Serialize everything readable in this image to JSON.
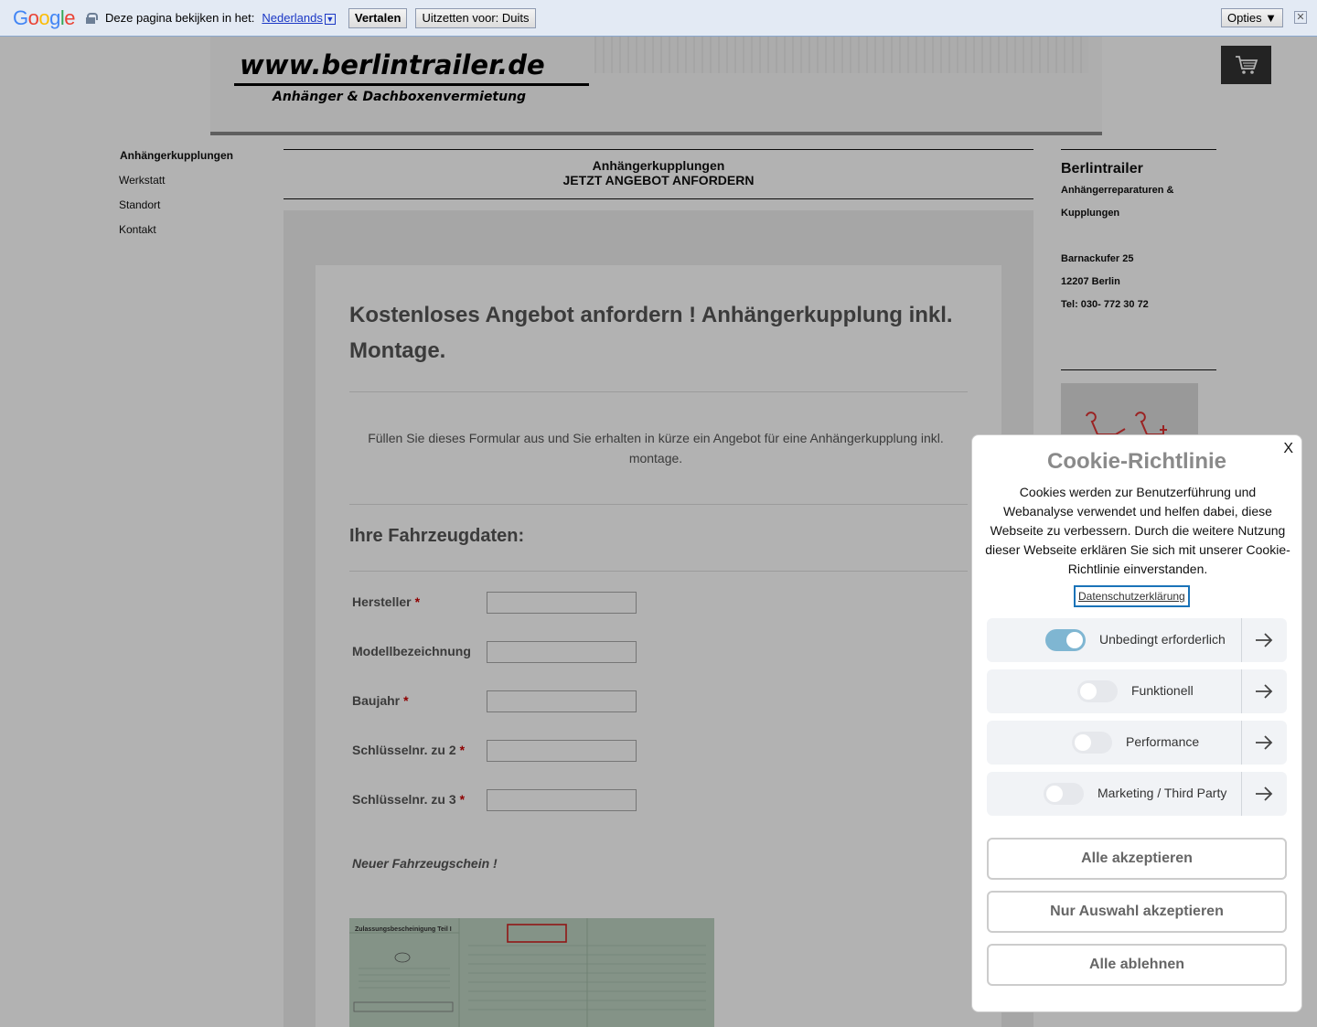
{
  "translate_bar": {
    "logo": "Google",
    "prompt": "Deze pagina bekijken in het:",
    "language": "Nederlands",
    "translate_label": "Vertalen",
    "turn_off_label": "Uitzetten voor: Duits",
    "options_label": "Opties ▼",
    "close_label": "✕"
  },
  "header": {
    "site_title": "www.berlintrailer.de",
    "site_subtitle": "Anhänger & Dachboxenvermietung"
  },
  "nav": {
    "items": [
      {
        "label": "Anhängerkupplungen"
      },
      {
        "label": "Werkstatt"
      },
      {
        "label": "Standort"
      },
      {
        "label": "Kontakt"
      }
    ]
  },
  "main": {
    "heading_line1": "Anhängerkupplungen",
    "heading_line2": "JETZT ANGEBOT ANFORDERN",
    "form_title": "Kostenloses Angebot anfordern ! Anhängerkupplung inkl. Montage.",
    "form_intro": "Füllen Sie dieses Formular aus und Sie erhalten in kürze ein Angebot für eine Anhängerkupplung inkl. montage.",
    "section_title": "Ihre Fahrzeugdaten:",
    "required_mark": "*",
    "fields": [
      {
        "label": "Hersteller",
        "required": true,
        "value": ""
      },
      {
        "label": "Modellbezeichnung",
        "required": false,
        "value": ""
      },
      {
        "label": "Baujahr",
        "required": true,
        "value": ""
      },
      {
        "label": "Schlüsselnr. zu 2",
        "required": true,
        "value": ""
      },
      {
        "label": "Schlüsselnr. zu 3",
        "required": true,
        "value": ""
      }
    ],
    "note": "Neuer Fahrzeugschein !",
    "doc_caption": "Zulassungsbescheinigung Teil I"
  },
  "sidebar": {
    "title": "Berlintrailer",
    "line1": "Anhängerreparaturen &",
    "line2": "Kupplungen",
    "street": "Barnackufer 25",
    "city": "12207 Berlin",
    "phone": "Tel: 030- 772 30 72"
  },
  "cookie": {
    "close_label": "X",
    "title": "Cookie-Richtlinie",
    "text": "Cookies werden zur Benutzerführung und Webanalyse verwendet und helfen dabei, diese Webseite zu verbessern. Durch die weitere Nutzung dieser Webseite erklären Sie sich mit unserer Cookie-Richtlinie einverstanden.",
    "privacy_link": "Datenschutzerklärung",
    "categories": [
      {
        "label": "Unbedingt erforderlich",
        "enabled": true
      },
      {
        "label": "Funktionell",
        "enabled": false
      },
      {
        "label": "Performance",
        "enabled": false
      },
      {
        "label": "Marketing / Third Party",
        "enabled": false
      }
    ],
    "accept_all": "Alle akzeptieren",
    "accept_selection": "Nur Auswahl akzeptieren",
    "reject_all": "Alle ablehnen"
  },
  "colors": {
    "accent_toggle_on": "#7fb6d2",
    "required": "#cc0000",
    "cart_bg": "#333333"
  }
}
